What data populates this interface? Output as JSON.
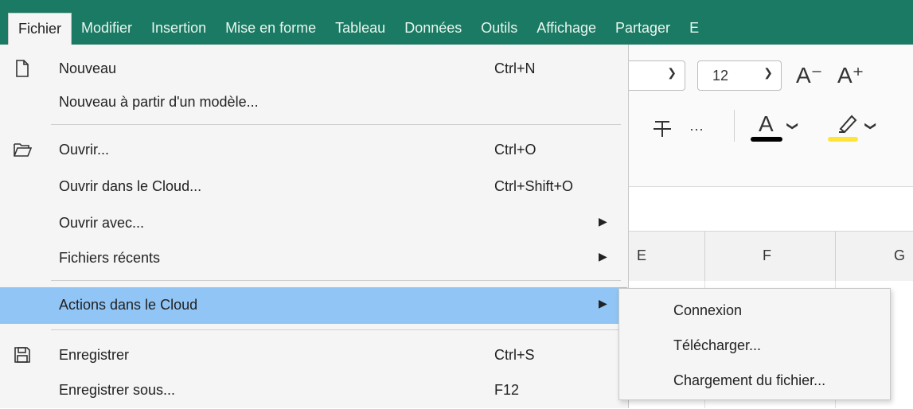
{
  "menubar": {
    "items": [
      "Fichier",
      "Modifier",
      "Insertion",
      "Mise en forme",
      "Tableau",
      "Données",
      "Outils",
      "Affichage",
      "Partager",
      "E"
    ]
  },
  "toolbar": {
    "font_size": "12",
    "increase_font": "A⁺",
    "decrease_font": "A⁻",
    "font_color_letter": "A",
    "font_color": "#000000",
    "highlight_color": "#ffe43a",
    "more": "···"
  },
  "sheet": {
    "columns": [
      "E",
      "F",
      "G"
    ]
  },
  "file_menu": {
    "items": [
      {
        "label": "Nouveau",
        "shortcut": "Ctrl+N",
        "icon": "new-document-icon"
      },
      {
        "label": "Nouveau à partir d'un modèle...",
        "shortcut": ""
      },
      {
        "label": "Ouvrir...",
        "shortcut": "Ctrl+O",
        "icon": "open-folder-icon"
      },
      {
        "label": "Ouvrir dans le Cloud...",
        "shortcut": "Ctrl+Shift+O"
      },
      {
        "label": "Ouvrir avec...",
        "shortcut": "",
        "submenu": true
      },
      {
        "label": "Fichiers récents",
        "shortcut": "",
        "submenu": true
      },
      {
        "label": "Actions dans le Cloud",
        "shortcut": "",
        "submenu": true,
        "highlighted": true
      },
      {
        "label": "Enregistrer",
        "shortcut": "Ctrl+S",
        "icon": "save-icon"
      },
      {
        "label": "Enregistrer sous...",
        "shortcut": "F12"
      }
    ]
  },
  "submenu": {
    "items": [
      "Connexion",
      "Télécharger...",
      "Chargement du fichier..."
    ]
  },
  "colors": {
    "menubar": "#1a7a63",
    "highlight": "#91c5f5",
    "menu_bg": "#f5f5f5"
  }
}
